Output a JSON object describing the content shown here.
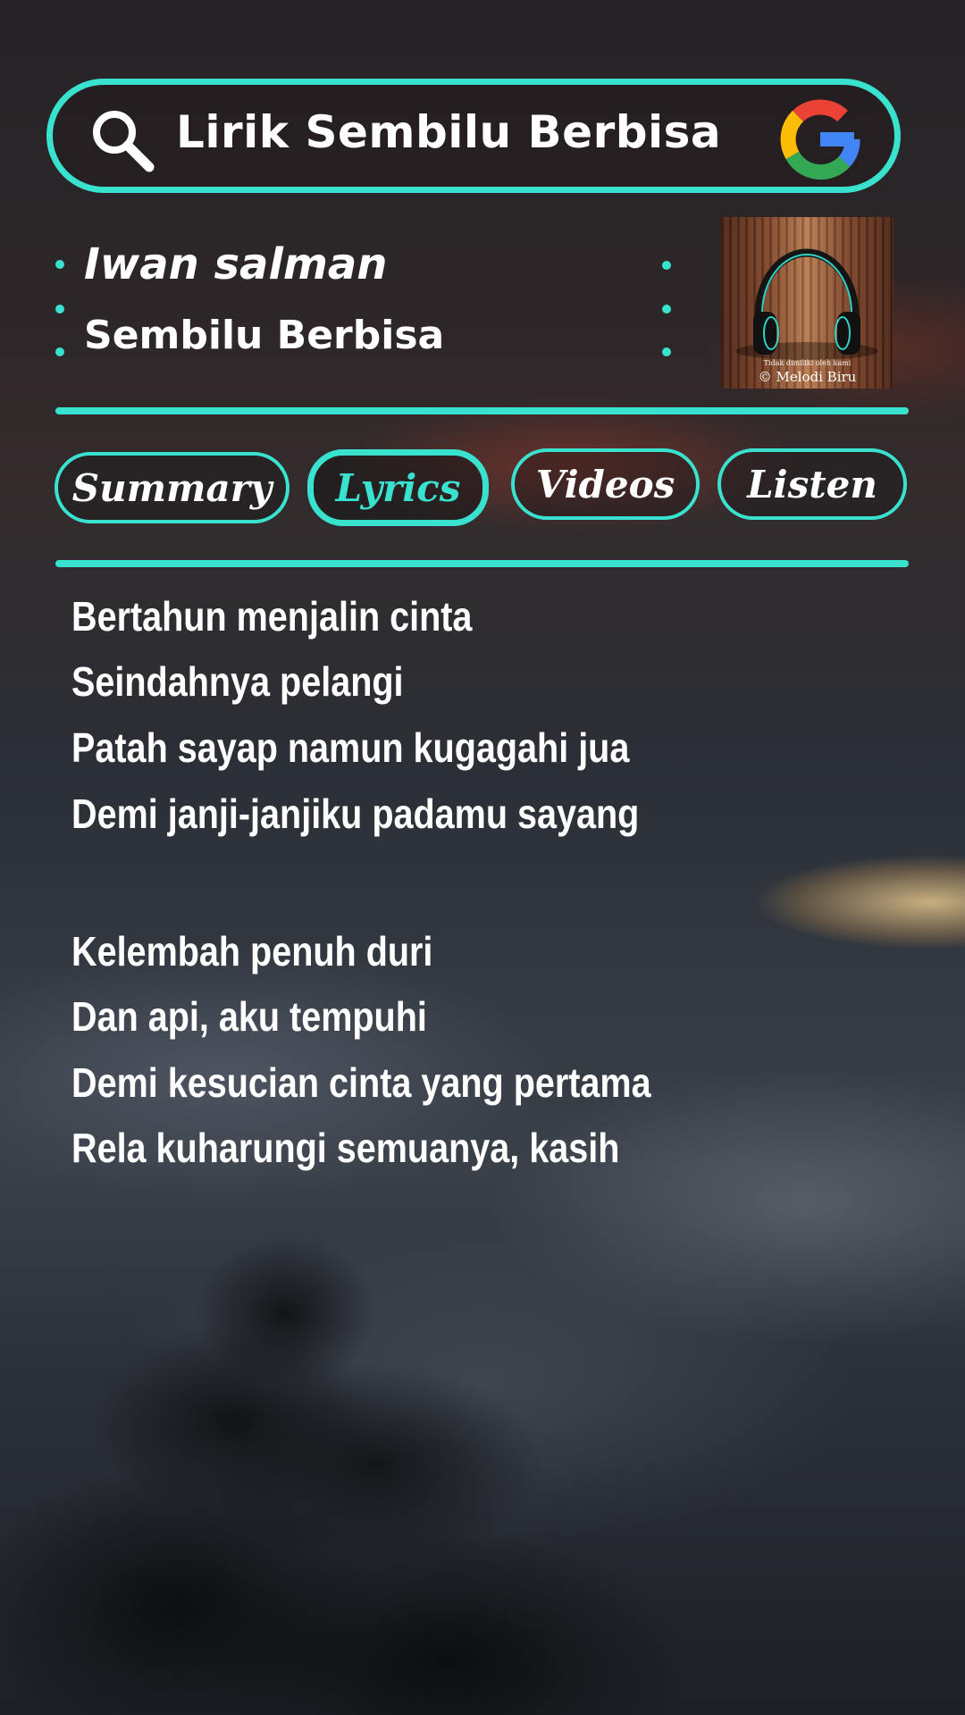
{
  "search": {
    "query": "Lirik Sembilu Berbisa",
    "icon": "search-icon",
    "brand_icon": "google-icon"
  },
  "track": {
    "artist": "Iwan salman",
    "title": "Sembilu Berbisa"
  },
  "thumbnail": {
    "icon": "headphones-icon",
    "small_text": "Tidak dimiliki oleh kami",
    "caption": "© Melodi Biru"
  },
  "tabs": [
    {
      "label": "Summary",
      "active": false
    },
    {
      "label": "Lyrics",
      "active": true
    },
    {
      "label": "Videos",
      "active": false
    },
    {
      "label": "Listen",
      "active": false
    }
  ],
  "lyrics": {
    "verse1": [
      "Bertahun menjalin cinta",
      "Seindahnya pelangi",
      "Patah sayap namun kugagahi jua",
      "Demi janji-janjiku padamu sayang"
    ],
    "verse2": [
      "Kelembah penuh duri",
      "Dan api, aku tempuhi",
      "Demi kesucian cinta yang pertama",
      "Rela kuharungi semuanya, kasih"
    ]
  },
  "colors": {
    "accent": "#39e2cf",
    "text": "#ffffff"
  }
}
